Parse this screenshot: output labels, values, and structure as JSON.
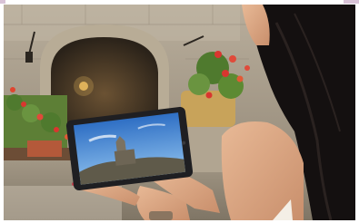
{
  "scene": {
    "subject": "woman-holding-tablet",
    "tablet_screen": "castle-tower-on-hill",
    "setting": "stone-courtyard-with-flowers"
  },
  "colors": {
    "accent_border": "#d9c3d7",
    "stone_wall": "#a89d8c",
    "archway_shadow": "#3c3226",
    "flower_red": "#d9362f",
    "foliage_green": "#4f7a2e",
    "hair": "#141010",
    "skin": "#d9a483",
    "sky_blue": "#3f86d8"
  }
}
